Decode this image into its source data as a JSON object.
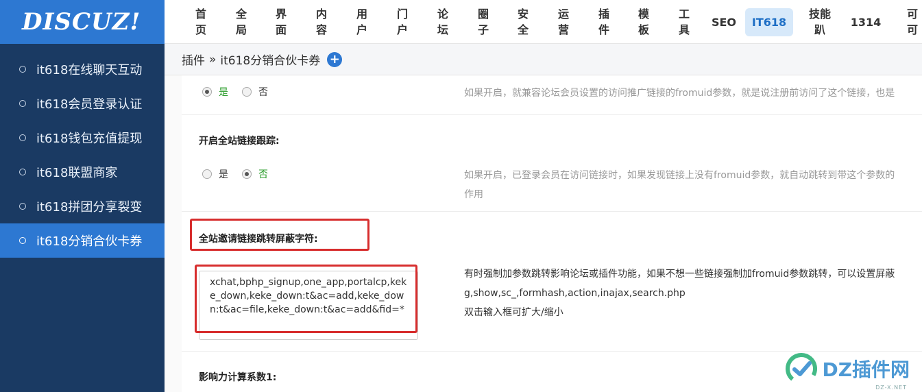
{
  "logo": {
    "text": "DISCUZ!"
  },
  "sidebar": {
    "items": [
      {
        "label": "it618在线聊天互动"
      },
      {
        "label": "it618会员登录认证"
      },
      {
        "label": "it618钱包充值提现"
      },
      {
        "label": "it618联盟商家"
      },
      {
        "label": "it618拼团分享裂变"
      },
      {
        "label": "it618分销合伙卡券"
      }
    ]
  },
  "topnav": {
    "items": [
      {
        "line1": "首",
        "line2": "页"
      },
      {
        "line1": "全",
        "line2": "局"
      },
      {
        "line1": "界",
        "line2": "面"
      },
      {
        "line1": "内",
        "line2": "容"
      },
      {
        "line1": "用",
        "line2": "户"
      },
      {
        "line1": "门",
        "line2": "户"
      },
      {
        "line1": "论",
        "line2": "坛"
      },
      {
        "line1": "圈",
        "line2": "子"
      },
      {
        "line1": "安",
        "line2": "全"
      },
      {
        "line1": "运",
        "line2": "营"
      },
      {
        "line1": "插",
        "line2": "件"
      },
      {
        "line1": "模",
        "line2": "板"
      },
      {
        "line1": "工",
        "line2": "具"
      },
      {
        "line1": "SEO"
      },
      {
        "line1": "IT618"
      },
      {
        "line1": "技能",
        "line2": "趴"
      },
      {
        "line1": "1314"
      },
      {
        "line1": "可",
        "line2": "可"
      }
    ]
  },
  "breadcrumb": {
    "parent": "插件",
    "separator": "»",
    "current": "it618分销合伙卡券"
  },
  "settings": {
    "row1": {
      "yes": "是",
      "no": "否",
      "desc": "如果开启，就兼容论坛会员设置的访问推广链接的fromuid参数，就是说注册前访问了这个链接，也是"
    },
    "row2": {
      "label": "开启全站链接跟踪:",
      "yes": "是",
      "no": "否",
      "desc_line1": "如果开启，已登录会员在访问链接时，如果发现链接上没有fromuid参数，就自动跳转到带这个参数的",
      "desc_line2": "作用"
    },
    "row3": {
      "label": "全站邀请链接跳转屏蔽字符:",
      "value": "xchat,bphp_signup,one_app,portalcp,keke_down,keke_down:t&ac=add,keke_down:t&ac=file,keke_down:t&ac=add&fid=*",
      "desc_line1": "有时强制加参数跳转影响论坛或插件功能，如果不想一些链接强制加fromuid参数跳转，可以设置屏蔽",
      "desc_line2": "g,show,sc_,formhash,action,inajax,search.php",
      "desc_line3": "双击输入框可扩大/缩小"
    },
    "row4": {
      "label": "影响力计算系数1:"
    }
  },
  "watermark": {
    "text": "DZ插件网",
    "sub": "DZ-X.NET"
  },
  "colors": {
    "sidebar": "#1a3a63",
    "accent": "#2d78d2",
    "highlight": "#d72d2d"
  }
}
